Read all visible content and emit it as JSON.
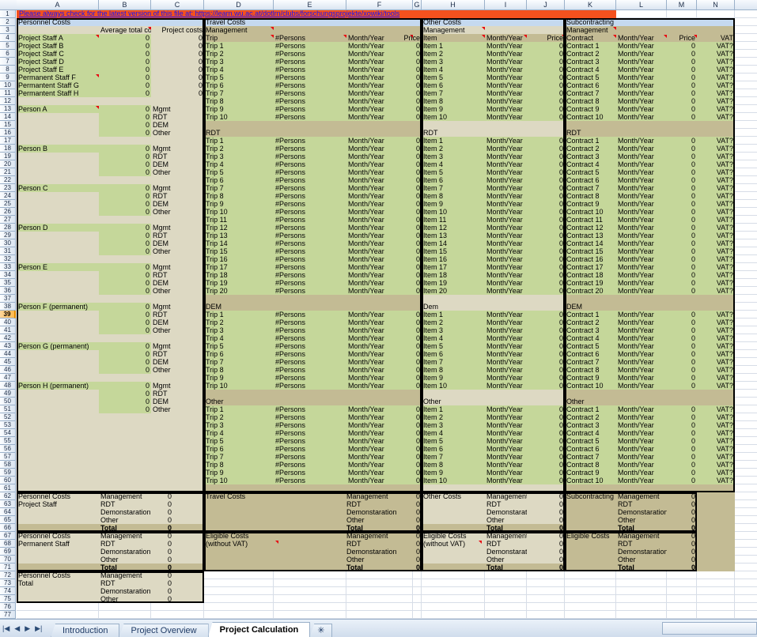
{
  "window": {
    "banner": "Please always check for the latest version of this file at: https://learn.wu.ac.at/dotlrn/clubs/forschungsprojekte/xowiki/tools"
  },
  "columns": [
    "A",
    "B",
    "C",
    "D",
    "E",
    "F",
    "G",
    "H",
    "I",
    "J",
    "K",
    "L",
    "M",
    "N"
  ],
  "selected_row": 39,
  "colors": {
    "banner_bg": "#f4511e",
    "banner_text": "#1414ff",
    "section_title_bg": "#c5d9ef",
    "group_header_bg": "#c3bb94",
    "group_header_light_bg": "#ddd9c3",
    "data_green_bg": "#c5d79a",
    "beige_bg": "#ddd9c3",
    "summary_khaki_bg": "#c3bb94",
    "note_marker": "#e8000d"
  },
  "sections": {
    "personnel": {
      "title": "Personnel Costs",
      "headers": [
        "Average total costs",
        "Project costs"
      ],
      "staff_rows": [
        "Project Staff  A",
        "Project Staff B",
        "Project Staff C",
        "Project Staff D",
        "Project Staff E",
        "Permanent Staff F",
        "Permantent Staff G",
        "Permantent Staff H"
      ],
      "staff_value": "0",
      "persons": [
        "Person A",
        "Person B",
        "Person C",
        "Person D",
        "Person E",
        "Person F (permanent)",
        "Person G (permanent)",
        "Person H (permanent)"
      ],
      "categories": [
        "Mgmt",
        "RDT",
        "DEM",
        "Other"
      ],
      "person_value": "0"
    },
    "travel": {
      "title": "Travel Costs",
      "headers": [
        "Trip",
        "#Persons",
        "Month/Year",
        "Price"
      ],
      "groups": [
        {
          "label": "Management",
          "count": 10
        },
        {
          "label": "RDT",
          "count": 20
        },
        {
          "label": "DEM",
          "count": 10
        },
        {
          "label": "Other",
          "count": 10
        }
      ],
      "row_prefix": "Trip",
      "persons_text": "#Persons",
      "month_text": "Month/Year",
      "price_value": "0"
    },
    "other": {
      "title": "Other Costs",
      "headers": [
        "Item",
        "Month/Year",
        "Price"
      ],
      "groups": [
        {
          "label": "Management",
          "count": 10
        },
        {
          "label": "RDT",
          "count": 20
        },
        {
          "label": "Dem",
          "count": 10
        },
        {
          "label": "Other",
          "count": 10
        }
      ],
      "row_prefix": "Item",
      "month_text": "Month/Year",
      "price_value": "0"
    },
    "subcontracting": {
      "title": "Subcontracting",
      "headers": [
        "Contract",
        "Month/Year",
        "Price",
        "VAT"
      ],
      "groups": [
        {
          "label": "Management",
          "count": 10
        },
        {
          "label": "RDT",
          "count": 20
        },
        {
          "label": "DEM",
          "count": 10
        },
        {
          "label": "Other",
          "count": 10
        }
      ],
      "row_prefix": "Contract",
      "month_text": "Month/Year",
      "price_value": "0",
      "vat_value": "VAT?"
    }
  },
  "summary": {
    "category_labels": [
      "Management",
      "RDT",
      "Demonstaration",
      "Other"
    ],
    "total_label": "Total",
    "zero": "0",
    "blocks": [
      {
        "title_line1": "Personnel Costs",
        "title_line2": "Project Staff"
      },
      {
        "title_line1": "Travel Costs",
        "title_line2": ""
      },
      {
        "title_line1": "Other Costs",
        "title_line2": ""
      },
      {
        "title_line1": "Subcontracting",
        "title_line2": ""
      },
      {
        "title_line1": "Personnel Costs",
        "title_line2": "Permanent Staff"
      },
      {
        "title_line1": "Eligible Costs",
        "title_line2": "(without VAT)"
      },
      {
        "title_line1": "Eligible Costs",
        "title_line2": "(without VAT)"
      },
      {
        "title_line1": "Eligible Costs",
        "title_line2": ""
      },
      {
        "title_line1": "Personnel Costs",
        "title_line2": "Total"
      }
    ]
  },
  "tabbar": {
    "nav": [
      "|◀",
      "◀",
      "▶",
      "▶|"
    ],
    "tabs": [
      {
        "label": "Introduction",
        "active": false
      },
      {
        "label": "Project Overview",
        "active": false
      },
      {
        "label": "Project Calculation",
        "active": true
      }
    ],
    "new_sheet_label": "✳"
  }
}
